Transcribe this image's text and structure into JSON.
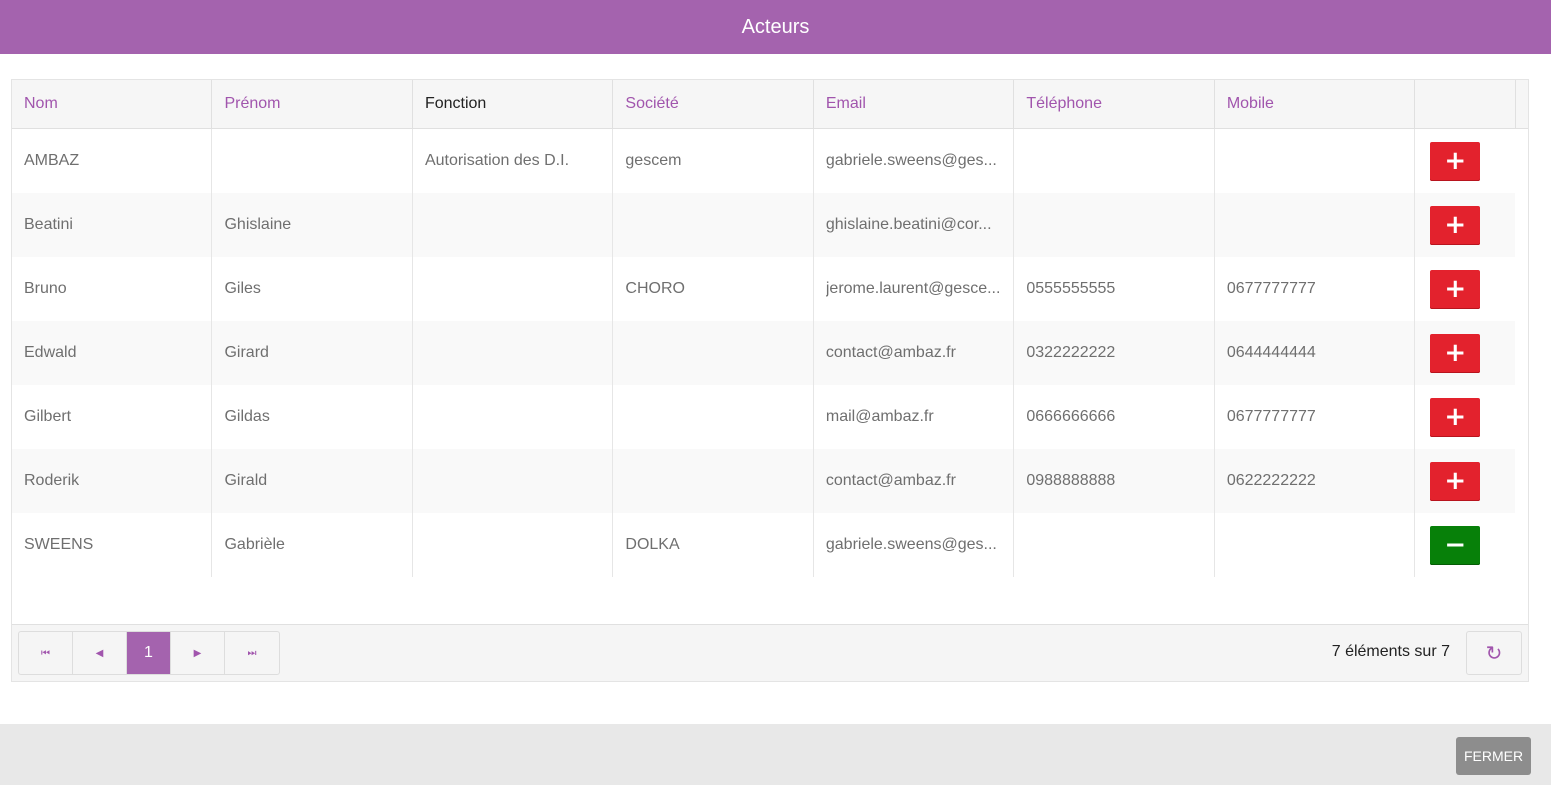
{
  "dialog": {
    "title": "Acteurs"
  },
  "table": {
    "columns": [
      "Nom",
      "Prénom",
      "Fonction",
      "Société",
      "Email",
      "Téléphone",
      "Mobile"
    ],
    "rows": [
      {
        "nom": "AMBAZ",
        "prenom": "",
        "fonction": "Autorisation des D.I.",
        "societe": "gescem",
        "email": "gabriele.sweens@ges...",
        "telephone": "",
        "mobile": "",
        "action": "add"
      },
      {
        "nom": "Beatini",
        "prenom": "Ghislaine",
        "fonction": "",
        "societe": "",
        "email": "ghislaine.beatini@cor...",
        "telephone": "",
        "mobile": "",
        "action": "add"
      },
      {
        "nom": "Bruno",
        "prenom": "Giles",
        "fonction": "",
        "societe": "CHORO",
        "email": "jerome.laurent@gesce...",
        "telephone": "0555555555",
        "mobile": "0677777777",
        "action": "add"
      },
      {
        "nom": "Edwald",
        "prenom": "Girard",
        "fonction": "",
        "societe": "",
        "email": "contact@ambaz.fr",
        "telephone": "0322222222",
        "mobile": "0644444444",
        "action": "add"
      },
      {
        "nom": "Gilbert",
        "prenom": "Gildas",
        "fonction": "",
        "societe": "",
        "email": "mail@ambaz.fr",
        "telephone": "0666666666",
        "mobile": "0677777777",
        "action": "add"
      },
      {
        "nom": "Roderik",
        "prenom": "Girald",
        "fonction": "",
        "societe": "",
        "email": "contact@ambaz.fr",
        "telephone": "0988888888",
        "mobile": "0622222222",
        "action": "add"
      },
      {
        "nom": "SWEENS",
        "prenom": "Gabrièle",
        "fonction": "",
        "societe": "DOLKA",
        "email": "gabriele.sweens@ges...",
        "telephone": "",
        "mobile": "",
        "action": "remove"
      }
    ],
    "action_icons": {
      "add": "+",
      "remove": "−"
    }
  },
  "pager": {
    "current_page": "1",
    "info": "7 éléments sur 7",
    "icons": {
      "first": "⏮",
      "prev": "◀",
      "next": "▶",
      "last": "⏭",
      "refresh": "↻"
    }
  },
  "footer": {
    "close_label": "FERMER"
  },
  "colors": {
    "accent": "#a463ae",
    "add": "#e3222d",
    "remove": "#078009",
    "close": "#8d8d8d"
  }
}
